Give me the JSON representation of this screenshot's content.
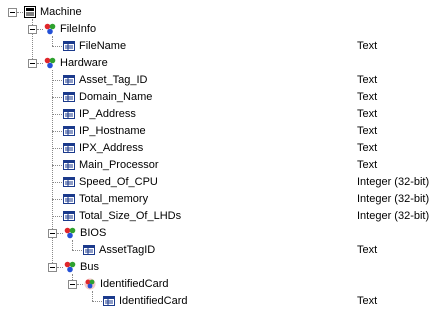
{
  "tree": [
    {
      "label": "Machine",
      "icon": "table-icon",
      "expanded": true,
      "type": "",
      "level": 0,
      "has_toggle": true
    },
    {
      "label": "FileInfo",
      "icon": "link-group-icon",
      "expanded": true,
      "type": "",
      "level": 1,
      "has_toggle": true
    },
    {
      "label": "FileName",
      "icon": "field-icon",
      "expanded": false,
      "type": "Text",
      "level": 2,
      "has_toggle": false
    },
    {
      "label": "Hardware",
      "icon": "link-group-icon",
      "expanded": true,
      "type": "",
      "level": 1,
      "has_toggle": true
    },
    {
      "label": "Asset_Tag_ID",
      "icon": "field-icon",
      "expanded": false,
      "type": "Text",
      "level": 2,
      "has_toggle": false
    },
    {
      "label": "Domain_Name",
      "icon": "field-icon",
      "expanded": false,
      "type": "Text",
      "level": 2,
      "has_toggle": false
    },
    {
      "label": "IP_Address",
      "icon": "field-icon",
      "expanded": false,
      "type": "Text",
      "level": 2,
      "has_toggle": false
    },
    {
      "label": "IP_Hostname",
      "icon": "field-icon",
      "expanded": false,
      "type": "Text",
      "level": 2,
      "has_toggle": false
    },
    {
      "label": "IPX_Address",
      "icon": "field-icon",
      "expanded": false,
      "type": "Text",
      "level": 2,
      "has_toggle": false
    },
    {
      "label": "Main_Processor",
      "icon": "field-icon",
      "expanded": false,
      "type": "Text",
      "level": 2,
      "has_toggle": false
    },
    {
      "label": "Speed_Of_CPU",
      "icon": "field-icon",
      "expanded": false,
      "type": "Integer (32-bit)",
      "level": 2,
      "has_toggle": false
    },
    {
      "label": "Total_memory",
      "icon": "field-icon",
      "expanded": false,
      "type": "Integer (32-bit)",
      "level": 2,
      "has_toggle": false
    },
    {
      "label": "Total_Size_Of_LHDs",
      "icon": "field-icon",
      "expanded": false,
      "type": "Integer (32-bit)",
      "level": 2,
      "has_toggle": false
    },
    {
      "label": "BIOS",
      "icon": "link-group-icon",
      "expanded": true,
      "type": "",
      "level": 2,
      "has_toggle": true
    },
    {
      "label": "AssetTagID",
      "icon": "field-icon",
      "expanded": false,
      "type": "Text",
      "level": 3,
      "has_toggle": false
    },
    {
      "label": "Bus",
      "icon": "link-group-icon",
      "expanded": true,
      "type": "",
      "level": 2,
      "has_toggle": true
    },
    {
      "label": "IdentifiedCard",
      "icon": "link-card-icon",
      "expanded": true,
      "type": "",
      "level": 3,
      "has_toggle": true
    },
    {
      "label": "IdentifiedCard",
      "icon": "field-icon",
      "expanded": false,
      "type": "Text",
      "level": 4,
      "has_toggle": false
    }
  ],
  "colors": {
    "connector": "#8a8a8a",
    "field_icon_border": "#1b3a8c",
    "link_red": "#e0262b",
    "link_blue": "#2350d6",
    "link_green": "#2ea12e"
  }
}
